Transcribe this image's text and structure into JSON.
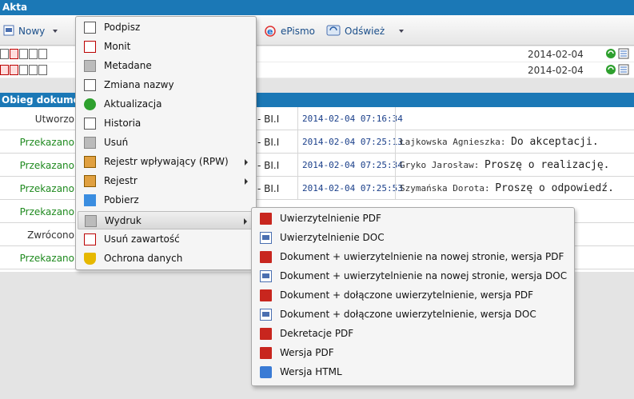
{
  "window": {
    "title": "Akta"
  },
  "toolbar": {
    "new_label": "Nowy",
    "epismo_label": "ePismo",
    "refresh_label": "Odśwież"
  },
  "documents": [
    {
      "date": "2014-02-04"
    },
    {
      "date": "2014-02-04"
    }
  ],
  "section": {
    "title": "Obieg dokumen"
  },
  "log": [
    {
      "status": "Utworzo",
      "status_color": "black",
      "unit": "- BI.I",
      "timestamp": "2014-02-04 07:16:34",
      "person": "",
      "message": ""
    },
    {
      "status": "Przekazano",
      "status_color": "green",
      "unit": "- BI.I",
      "timestamp": "2014-02-04 07:25:13",
      "person": "Łajkowska Agnieszka:",
      "message": "Do akceptacji."
    },
    {
      "status": "Przekazano",
      "status_color": "green",
      "unit": "- BI.I",
      "timestamp": "2014-02-04 07:25:34",
      "person": "Gryko Jarosław:",
      "message": "Proszę o realizację."
    },
    {
      "status": "Przekazano",
      "status_color": "green",
      "unit": "- BI.I",
      "timestamp": "2014-02-04 07:25:53",
      "person": "Szymańska Dorota:",
      "message": "Proszę o odpowiedź."
    },
    {
      "status": "Przekazano",
      "status_color": "green",
      "unit": "",
      "timestamp": "",
      "person": "",
      "message": ""
    },
    {
      "status": "Zwrócono",
      "status_color": "black",
      "unit": "",
      "timestamp": "",
      "person": "",
      "message": ""
    },
    {
      "status": "Przekazano",
      "status_color": "green",
      "unit": "",
      "timestamp": "",
      "person": "",
      "message": ""
    }
  ],
  "context_menu": {
    "items": [
      {
        "label": "Podpisz",
        "icon": "sign-icon"
      },
      {
        "label": "Monit",
        "icon": "bookmark-icon"
      },
      {
        "label": "Metadane",
        "icon": "metadata-icon"
      },
      {
        "label": "Zmiana nazwy",
        "icon": "rename-icon"
      },
      {
        "label": "Aktualizacja",
        "icon": "refresh-icon"
      },
      {
        "label": "Historia",
        "icon": "history-icon"
      },
      {
        "label": "Usuń",
        "icon": "trash-icon"
      },
      {
        "label": "Rejestr wpływający (RPW)",
        "icon": "register-in-icon",
        "submenu": true
      },
      {
        "label": "Rejestr",
        "icon": "register-icon",
        "submenu": true
      },
      {
        "label": "Pobierz",
        "icon": "download-icon"
      },
      {
        "label": "Wydruk",
        "icon": "printer-icon",
        "submenu": true,
        "highlighted": true
      },
      {
        "label": "Usuń zawartość",
        "icon": "clear-content-icon"
      },
      {
        "label": "Ochrona danych",
        "icon": "shield-icon"
      }
    ]
  },
  "print_submenu": {
    "items": [
      {
        "label": "Uwierzytelnienie PDF",
        "icon": "pdf-icon"
      },
      {
        "label": "Uwierzytelnienie DOC",
        "icon": "doc-icon"
      },
      {
        "label": "Dokument + uwierzytelnienie na nowej stronie, wersja PDF",
        "icon": "pdf-icon"
      },
      {
        "label": "Dokument + uwierzytelnienie na nowej stronie, wersja DOC",
        "icon": "doc-icon"
      },
      {
        "label": "Dokument + dołączone uwierzytelnienie, wersja PDF",
        "icon": "pdf-icon"
      },
      {
        "label": "Dokument + dołączone uwierzytelnienie, wersja DOC",
        "icon": "doc-icon"
      },
      {
        "label": "Dekretacje PDF",
        "icon": "pdf-icon"
      },
      {
        "label": "Wersja PDF",
        "icon": "pdf-icon"
      },
      {
        "label": "Wersja HTML",
        "icon": "html-icon"
      }
    ]
  },
  "colors": {
    "header_blue": "#1b78b6",
    "status_green": "#1f8a1f",
    "timestamp_blue": "#1a3f8a"
  }
}
